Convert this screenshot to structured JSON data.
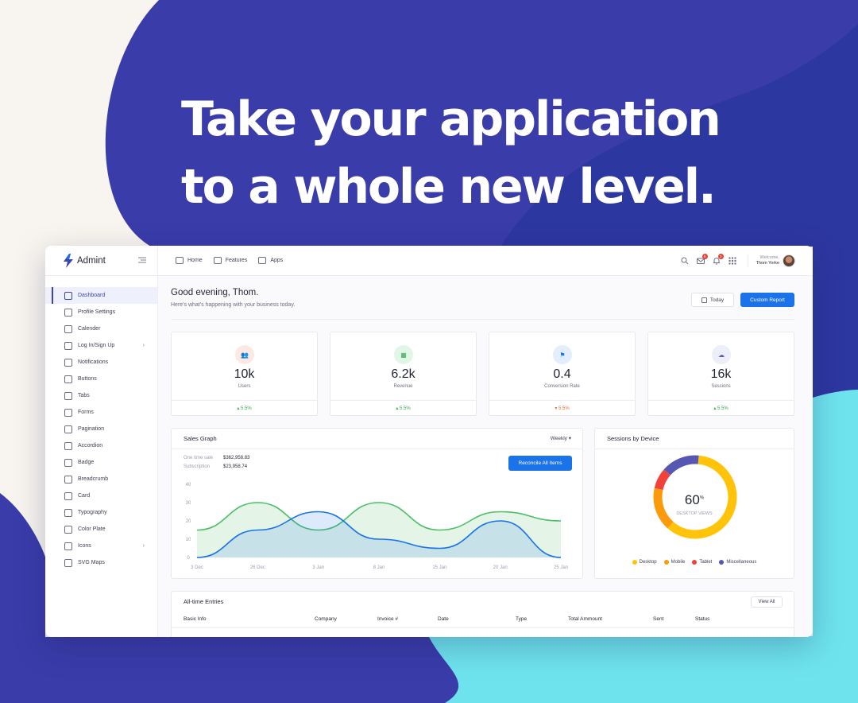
{
  "promo": {
    "headline_line1": "Take your application",
    "headline_line2": "to a whole new level."
  },
  "colors": {
    "indigo": "#3a3caa",
    "navy": "#2d37a0",
    "cyan": "#6ee3ee",
    "primary_button": "#1a73e8",
    "active_nav": "#3d44b0"
  },
  "app": {
    "brand": "Admint",
    "logo_icon": "lightning-icon",
    "sidebar": [
      {
        "label": "Dashboard",
        "icon": "dashboard-icon",
        "active": true
      },
      {
        "label": "Profile Settings",
        "icon": "gear-icon"
      },
      {
        "label": "Calender",
        "icon": "calendar-icon"
      },
      {
        "label": "Log In/Sign Up",
        "icon": "user-icon",
        "has_submenu": true
      },
      {
        "label": "Notifications",
        "icon": "cloud-icon"
      },
      {
        "label": "Buttons",
        "icon": "folder-icon"
      },
      {
        "label": "Tabs",
        "icon": "tabs-icon"
      },
      {
        "label": "Forms",
        "icon": "form-icon"
      },
      {
        "label": "Pagination",
        "icon": "flag-icon"
      },
      {
        "label": "Accordion",
        "icon": "accordion-icon"
      },
      {
        "label": "Badge",
        "icon": "badge-icon"
      },
      {
        "label": "Breadcrumb",
        "icon": "breadcrumb-icon"
      },
      {
        "label": "Card",
        "icon": "card-icon"
      },
      {
        "label": "Typography",
        "icon": "typography-icon"
      },
      {
        "label": "Color Plate",
        "icon": "droplet-icon"
      },
      {
        "label": "Icons",
        "icon": "icons-icon",
        "has_submenu": true
      },
      {
        "label": "SVG Maps",
        "icon": "compass-icon"
      }
    ],
    "topnav": [
      {
        "label": "Home",
        "icon": "home-icon"
      },
      {
        "label": "Features",
        "icon": "features-icon"
      },
      {
        "label": "Apps",
        "icon": "folder-icon"
      }
    ],
    "notifications": {
      "mail_count": "5",
      "bell_count": "3"
    },
    "user": {
      "welcome": "Welcome,",
      "name": "Thom Yorke"
    },
    "greeting": "Good evening, Thom.",
    "greeting_sub": "Here's what's happening with your business today.",
    "today_button": "Today",
    "custom_report_button": "Custom Report",
    "stats": [
      {
        "value": "10k",
        "label": "Users",
        "change": "5.5%",
        "trend": "up",
        "icon": "users-icon",
        "icon_bg": "#fde9e3",
        "icon_color": "#e8663c"
      },
      {
        "value": "6.2k",
        "label": "Revenue",
        "change": "5.5%",
        "trend": "up",
        "icon": "store-icon",
        "icon_bg": "#e2f6e8",
        "icon_color": "#34a853"
      },
      {
        "value": "0.4",
        "label": "Conversion Rate",
        "change": "5.5%",
        "trend": "down",
        "icon": "flag-icon",
        "icon_bg": "#e3eefc",
        "icon_color": "#1a73e8"
      },
      {
        "value": "16k",
        "label": "Sessions",
        "change": "5.5%",
        "trend": "up",
        "icon": "cloud-icon",
        "icon_bg": "#eceef8",
        "icon_color": "#5a5ea8"
      }
    ],
    "sales_graph": {
      "title": "Sales Graph",
      "period": "Weekly",
      "one_time_label": "One time sale",
      "one_time_value": "$362,958.83",
      "subscription_label": "Subscription",
      "subscription_value": "$23,958.74",
      "button": "Reconcile All Items"
    },
    "sessions_by_device": {
      "title": "Sessions by Device",
      "center_value": "60",
      "center_unit": "%",
      "center_label": "DESKTOP VIEWS"
    },
    "entries": {
      "title": "All-time Entries",
      "view_all": "View All",
      "columns": [
        "Basic Info",
        "Company",
        "Invoice #",
        "Date",
        "Type",
        "Total Ammount",
        "Sent",
        "Status"
      ]
    }
  },
  "chart_data": [
    {
      "type": "area",
      "categories": [
        "3 Dec",
        "26 Dec",
        "3 Jan",
        "8 Jan",
        "15 Jan",
        "20 Jan",
        "25 Jan"
      ],
      "ylim": [
        0,
        40
      ],
      "yticks": [
        0,
        10,
        20,
        30,
        40
      ],
      "series": [
        {
          "color": "#4cbf68",
          "values": [
            15,
            30,
            15,
            30,
            15,
            25,
            20
          ]
        },
        {
          "color": "#1a73e8",
          "values": [
            0,
            15,
            25,
            10,
            5,
            20,
            0
          ]
        }
      ]
    },
    {
      "type": "pie",
      "donut": true,
      "series": [
        {
          "name": "Desktop",
          "value": 60,
          "color": "#ffc40a"
        },
        {
          "name": "Mobile",
          "value": 17,
          "color": "#fb9b0b"
        },
        {
          "name": "Tablet",
          "value": 8,
          "color": "#f0423a"
        },
        {
          "name": "Miscellaneous",
          "value": 15,
          "color": "#5557b3"
        }
      ]
    }
  ]
}
